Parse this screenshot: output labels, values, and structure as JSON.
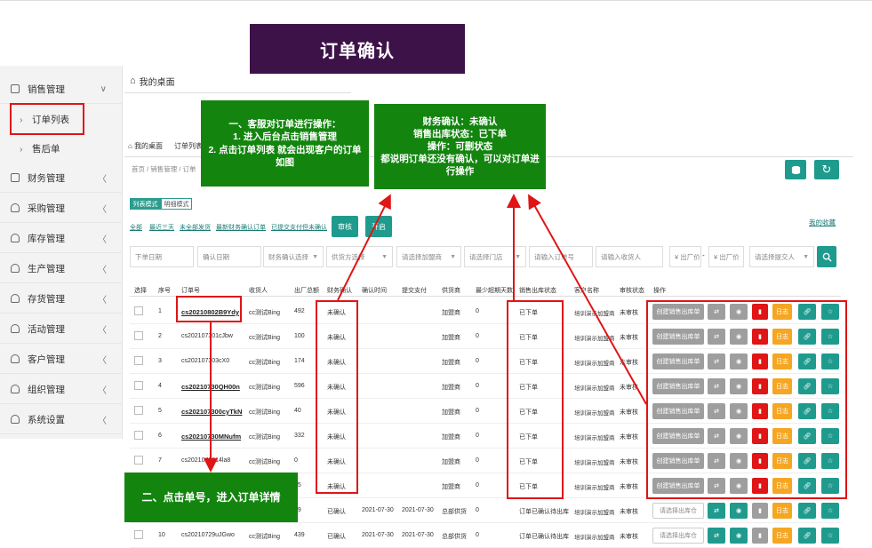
{
  "sidebar": {
    "items": [
      {
        "label": "销售管理",
        "arrow": "∨",
        "icon": "doc"
      },
      {
        "label": "订单列表",
        "sub": true
      },
      {
        "label": "售后单",
        "sub": true
      },
      {
        "label": "财务管理",
        "arrow": "〈",
        "icon": "doc"
      },
      {
        "label": "采购管理",
        "arrow": "〈",
        "icon": "person"
      },
      {
        "label": "库存管理",
        "arrow": "〈",
        "icon": "person"
      },
      {
        "label": "生产管理",
        "arrow": "〈",
        "icon": "person"
      },
      {
        "label": "存货管理",
        "arrow": "〈",
        "icon": "person"
      },
      {
        "label": "活动管理",
        "arrow": "〈",
        "icon": "person"
      },
      {
        "label": "客户管理",
        "arrow": "〈",
        "icon": "person"
      },
      {
        "label": "组织管理",
        "arrow": "〈",
        "icon": "person"
      },
      {
        "label": "系统设置",
        "arrow": "〈",
        "icon": "person"
      }
    ]
  },
  "header": {
    "home_tab": "我的桌面",
    "tab_home": "我的桌面",
    "tab_orders": "订单列表",
    "breadcrumb": "首页 / 销售管理 / 订单"
  },
  "view": {
    "list_mode": "列表模式",
    "detail_mode": "明细模式"
  },
  "filters": {
    "links": [
      "全部",
      "最近三天",
      "未全部发货",
      "最新财务确认订单",
      "已提交支付但未确认"
    ],
    "audit_button": "审核",
    "open_button": "开启",
    "my_favorites": "我的收藏",
    "fields": [
      {
        "text": "下单日期",
        "dropdown": false
      },
      {
        "text": "确认日期",
        "dropdown": false
      },
      {
        "text": "财务确认选择",
        "dropdown": true
      },
      {
        "text": "供货方选择",
        "dropdown": true
      },
      {
        "text": "请选择加盟商",
        "dropdown": true
      },
      {
        "text": "请选择门店",
        "dropdown": true
      },
      {
        "text": "请输入订单号",
        "dropdown": false
      },
      {
        "text": "请输入收货人",
        "dropdown": false
      },
      {
        "text": "¥ 出厂价",
        "dropdown": false
      },
      {
        "text": "¥ 出厂价",
        "dropdown": false
      },
      {
        "text": "请选择提交人",
        "dropdown": true
      }
    ],
    "range_separator": "-"
  },
  "table": {
    "headers": [
      "选择",
      "序号",
      "订单号",
      "收货人",
      "出厂总额",
      "财务确认",
      "确认时间",
      "提交支付",
      "供货商",
      "最少超期天数",
      "销售出库状态",
      "客户名称",
      "审核状态",
      "操作"
    ],
    "rows": [
      {
        "no": "1",
        "order": "cs20210802B9Ydy",
        "receiver": "cc测试Bing",
        "total": "492",
        "finance": "未确认",
        "confirm_time": "",
        "pay": "",
        "supplier": "加盟商",
        "days": "0",
        "status": "已下单",
        "customer": "培训演示加盟商",
        "audit": "未审核",
        "bold": true
      },
      {
        "no": "2",
        "order": "cs202107301cJbw",
        "receiver": "cc测试Bing",
        "total": "100",
        "finance": "未确认",
        "confirm_time": "",
        "pay": "",
        "supplier": "加盟商",
        "days": "0",
        "status": "已下单",
        "customer": "培训演示加盟商",
        "audit": "未审核",
        "bold": false
      },
      {
        "no": "3",
        "order": "cs202107303cX0",
        "receiver": "cc测试Bing",
        "total": "174",
        "finance": "未确认",
        "confirm_time": "",
        "pay": "",
        "supplier": "加盟商",
        "days": "0",
        "status": "已下单",
        "customer": "培训演示加盟商",
        "audit": "未审核",
        "bold": false
      },
      {
        "no": "4",
        "order": "cs20210730QH00n",
        "receiver": "cc测试Bing",
        "total": "596",
        "finance": "未确认",
        "confirm_time": "",
        "pay": "",
        "supplier": "加盟商",
        "days": "0",
        "status": "已下单",
        "customer": "培训演示加盟商",
        "audit": "未审核",
        "bold": true
      },
      {
        "no": "5",
        "order": "cs202107300cyTkN",
        "receiver": "cc测试Bing",
        "total": "40",
        "finance": "未确认",
        "confirm_time": "",
        "pay": "",
        "supplier": "加盟商",
        "days": "0",
        "status": "已下单",
        "customer": "培训演示加盟商",
        "audit": "未审核",
        "bold": true
      },
      {
        "no": "6",
        "order": "cs20210730MNufm",
        "receiver": "cc测试Bing",
        "total": "332",
        "finance": "未确认",
        "confirm_time": "",
        "pay": "",
        "supplier": "加盟商",
        "days": "0",
        "status": "已下单",
        "customer": "培训演示加盟商",
        "audit": "未审核",
        "bold": true
      },
      {
        "no": "7",
        "order": "cs2021073014la8",
        "receiver": "cc测试Bing",
        "total": "0",
        "finance": "未确认",
        "confirm_time": "",
        "pay": "",
        "supplier": "加盟商",
        "days": "0",
        "status": "已下单",
        "customer": "培训演示加盟商",
        "audit": "未审核",
        "bold": false
      },
      {
        "no": "8",
        "order": "",
        "receiver": "",
        "total": "65",
        "finance": "未确认",
        "confirm_time": "",
        "pay": "",
        "supplier": "加盟商",
        "days": "0",
        "status": "已下单",
        "customer": "培训演示加盟商",
        "audit": "未审核",
        "bold": false
      },
      {
        "no": "9",
        "order": "",
        "receiver": "",
        "total": "39",
        "finance": "已确认",
        "confirm_time": "2021-07-30",
        "pay": "2021-07-30",
        "supplier": "总部供货",
        "days": "0",
        "status": "订单已确认待出库",
        "customer": "培训演示加盟商",
        "audit": "未审核",
        "bold": false
      },
      {
        "no": "10",
        "order": "cs20210729uJGwo",
        "receiver": "cc测试Bing",
        "total": "439",
        "finance": "已确认",
        "confirm_time": "2021-07-30",
        "pay": "2021-07-30",
        "supplier": "总部供货",
        "days": "0",
        "status": "订单已确认待出库",
        "customer": "培训演示加盟商",
        "audit": "未审核",
        "bold": false
      }
    ],
    "op_create": "创建销售出库单",
    "op_select_warehouse": "请选择出库仓",
    "op_log": "日志"
  },
  "annotations": {
    "title": "订单确认",
    "step1": [
      "一、客服对订单进行操作：",
      "1. 进入后台点击销售管理",
      "2. 点击订单列表 就会出现客户的订单",
      "如图"
    ],
    "finance_note": [
      "财务确认：未确认",
      "销售出库状态：已下单",
      "操作：可删状态",
      "都说明订单还没有确认，可以对订单进",
      "行操作"
    ],
    "step2": "二、点击单号，进入订单详情"
  },
  "colors": {
    "teal": "#1f9b8e",
    "red": "#e01515",
    "orange": "#f5a623",
    "grey": "#9e9e9e",
    "annotation_green": "#13850f",
    "title_purple": "#3d1249"
  }
}
